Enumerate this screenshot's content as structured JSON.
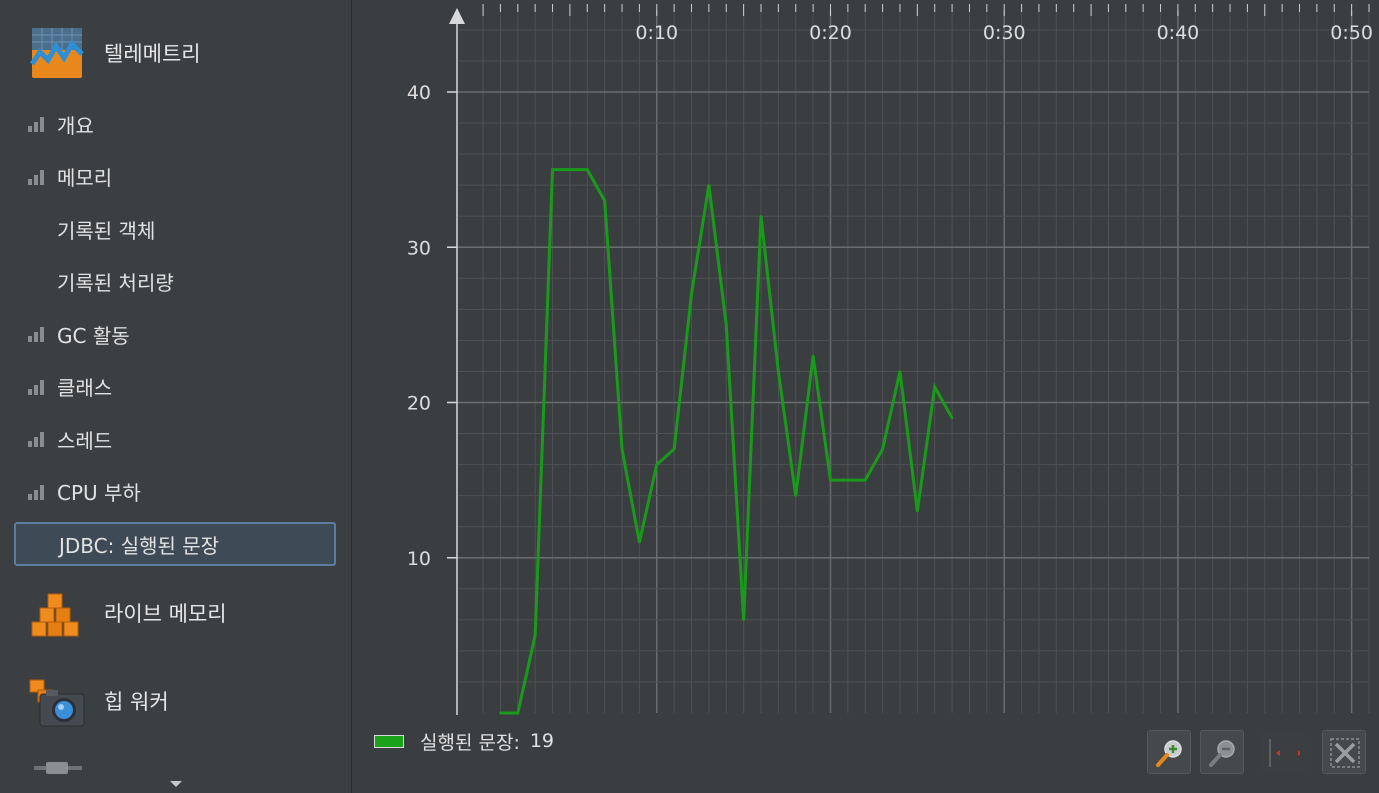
{
  "sidebar": {
    "telemetry": {
      "label": "텔레메트리",
      "icon": "telemetry-chart-icon"
    },
    "items": [
      {
        "label": "개요",
        "has_bars": true,
        "selected": false
      },
      {
        "label": "메모리",
        "has_bars": true,
        "selected": false
      },
      {
        "label": "기록된 객체",
        "has_bars": false,
        "selected": false
      },
      {
        "label": "기록된 처리량",
        "has_bars": false,
        "selected": false
      },
      {
        "label": "GC 활동",
        "has_bars": true,
        "selected": false
      },
      {
        "label": "클래스",
        "has_bars": true,
        "selected": false
      },
      {
        "label": "스레드",
        "has_bars": true,
        "selected": false
      },
      {
        "label": "CPU 부하",
        "has_bars": true,
        "selected": false
      },
      {
        "label": "JDBC: 실행된 문장",
        "has_bars": false,
        "selected": true
      }
    ],
    "live_memory": {
      "label": "라이브 메모리",
      "icon": "cubes-icon"
    },
    "heap_walker": {
      "label": "힙 워커",
      "icon": "camera-icon"
    },
    "more": {
      "icon": "connector-icon",
      "scroll_icon": "scroll-down-icon"
    }
  },
  "legend": {
    "series_name": "실행된 문장:",
    "current_value": "19",
    "color": "#1aa21a"
  },
  "toolbar": {
    "zoom_in_icon": "zoom-in-icon",
    "zoom_out_icon": "zoom-out-icon",
    "fit_icon": "fit-width-icon",
    "reset_icon": "reset-zoom-icon"
  },
  "colors": {
    "background": "#3c3f41",
    "grid_major": "#6a6d70",
    "grid_minor": "#4e5154",
    "line": "#1a9a1a",
    "selected_bg": "#3e4a56",
    "selected_border": "#5b7ea0"
  },
  "chart_data": {
    "type": "line",
    "title": "",
    "xlabel": "",
    "ylabel": "",
    "x_unit": "seconds",
    "x_ticks": [
      "0:10",
      "0:20",
      "0:30",
      "0:40",
      "0:50"
    ],
    "x_tick_values": [
      10,
      20,
      30,
      40,
      50
    ],
    "y_ticks": [
      10,
      20,
      30,
      40
    ],
    "xlim": [
      -1.5,
      51
    ],
    "ylim": [
      0,
      45
    ],
    "grid": true,
    "legend": "bottom-left",
    "series": [
      {
        "name": "실행된 문장",
        "color": "#1a9a1a",
        "x": [
          1,
          2,
          3,
          4,
          5,
          6,
          7,
          8,
          9,
          10,
          11,
          12,
          13,
          14,
          15,
          16,
          17,
          18,
          19,
          20,
          21,
          22,
          23,
          24,
          25,
          26,
          27
        ],
        "y": [
          0,
          0,
          5,
          35,
          35,
          35,
          33,
          17,
          11,
          16,
          17,
          27,
          34,
          25,
          6,
          32,
          22,
          14,
          23,
          15,
          15,
          15,
          17,
          22,
          13,
          21,
          19
        ]
      }
    ]
  }
}
